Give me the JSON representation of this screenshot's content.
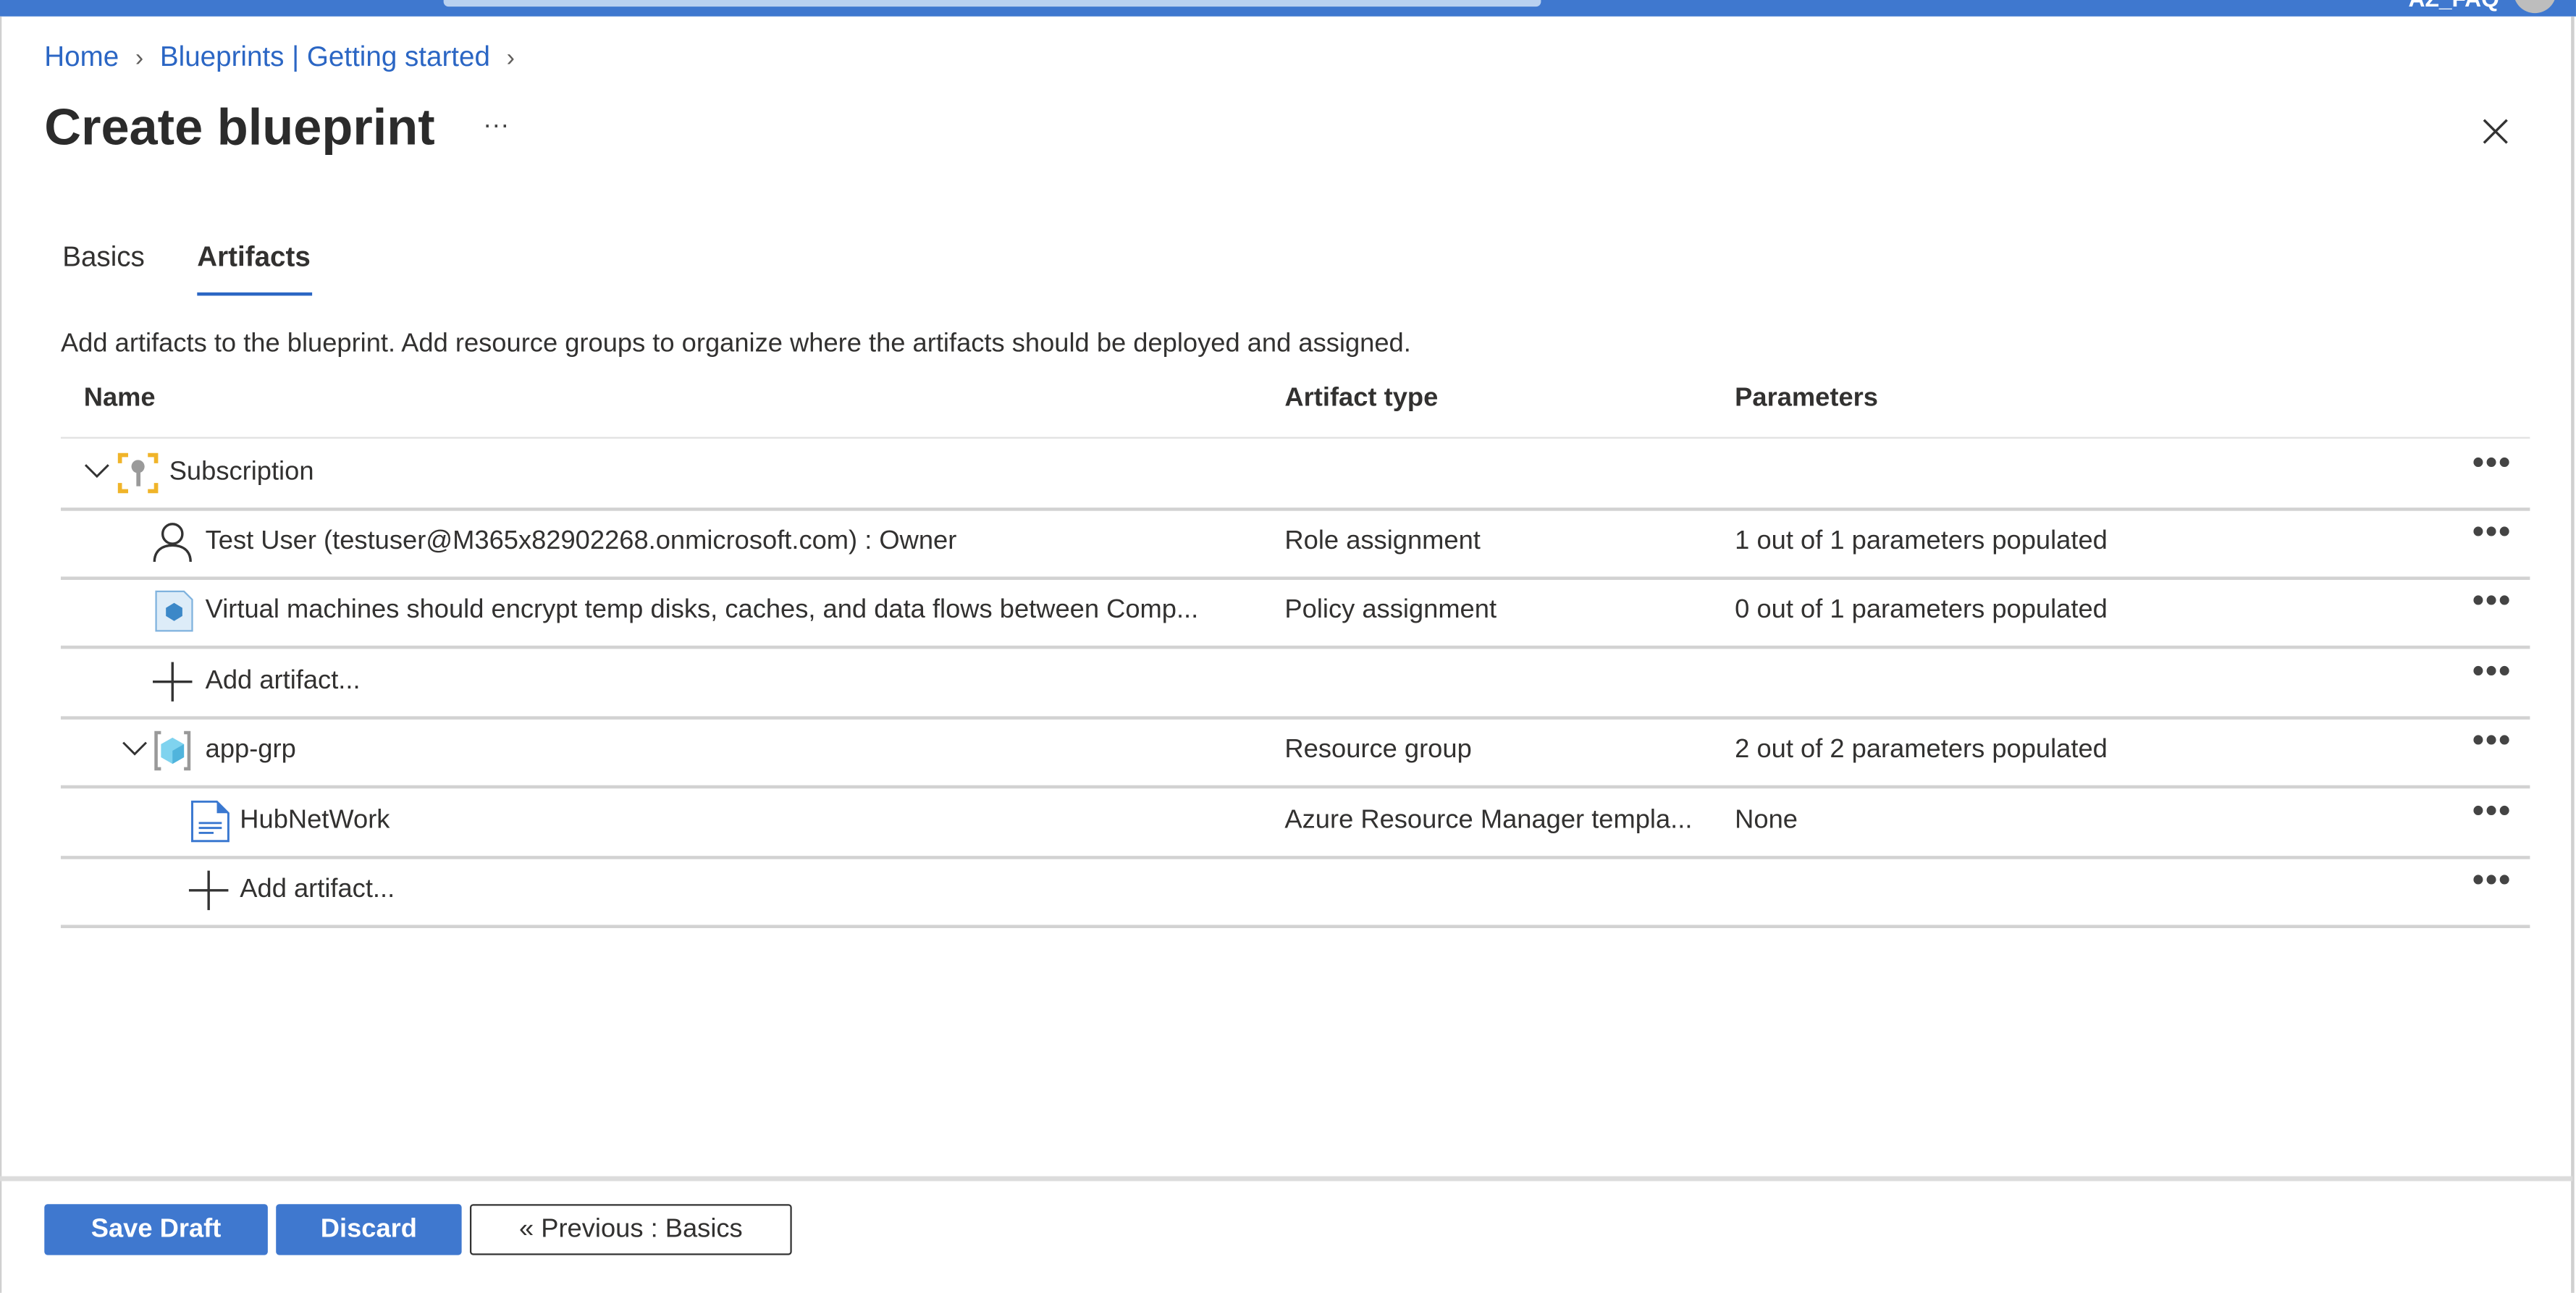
{
  "topbar": {
    "user": "AZ_FAQ",
    "accent": "#3f78cf"
  },
  "breadcrumb": [
    {
      "label": "Home"
    },
    {
      "label": "Blueprints | Getting started"
    }
  ],
  "page": {
    "title": "Create blueprint",
    "more": "···"
  },
  "tabs": [
    {
      "label": "Basics",
      "active": false
    },
    {
      "label": "Artifacts",
      "active": true
    }
  ],
  "description": "Add artifacts to the blueprint. Add resource groups to organize where the artifacts should be deployed and assigned.",
  "table": {
    "headers": [
      "Name",
      "Artifact type",
      "Parameters"
    ],
    "rows": [
      {
        "name": "Subscription",
        "type": "",
        "params": "",
        "icon": "subscription-key-icon",
        "expanded": true
      },
      {
        "name": "Test User (testuser@M365x82902268.onmicrosoft.com) : Owner",
        "type": "Role assignment",
        "params": "1 out of 1 parameters populated",
        "icon": "user-icon"
      },
      {
        "name": "Virtual machines should encrypt temp disks, caches, and data flows between Comp...",
        "type": "Policy assignment",
        "params": "0 out of 1 parameters populated",
        "icon": "policy-icon"
      },
      {
        "name": "Add artifact...",
        "type": "",
        "params": "",
        "icon": "plus-icon"
      },
      {
        "name": "app-grp",
        "type": "Resource group",
        "params": "2 out of 2 parameters populated",
        "icon": "resource-group-icon",
        "expanded": true
      },
      {
        "name": "HubNetWork",
        "type": "Azure Resource Manager templa...",
        "params": "None",
        "icon": "template-document-icon"
      },
      {
        "name": "Add artifact...",
        "type": "",
        "params": "",
        "icon": "plus-icon"
      }
    ],
    "row_menu": "•••"
  },
  "footer": {
    "save": "Save Draft",
    "discard": "Discard",
    "previous": "« Previous : Basics"
  }
}
